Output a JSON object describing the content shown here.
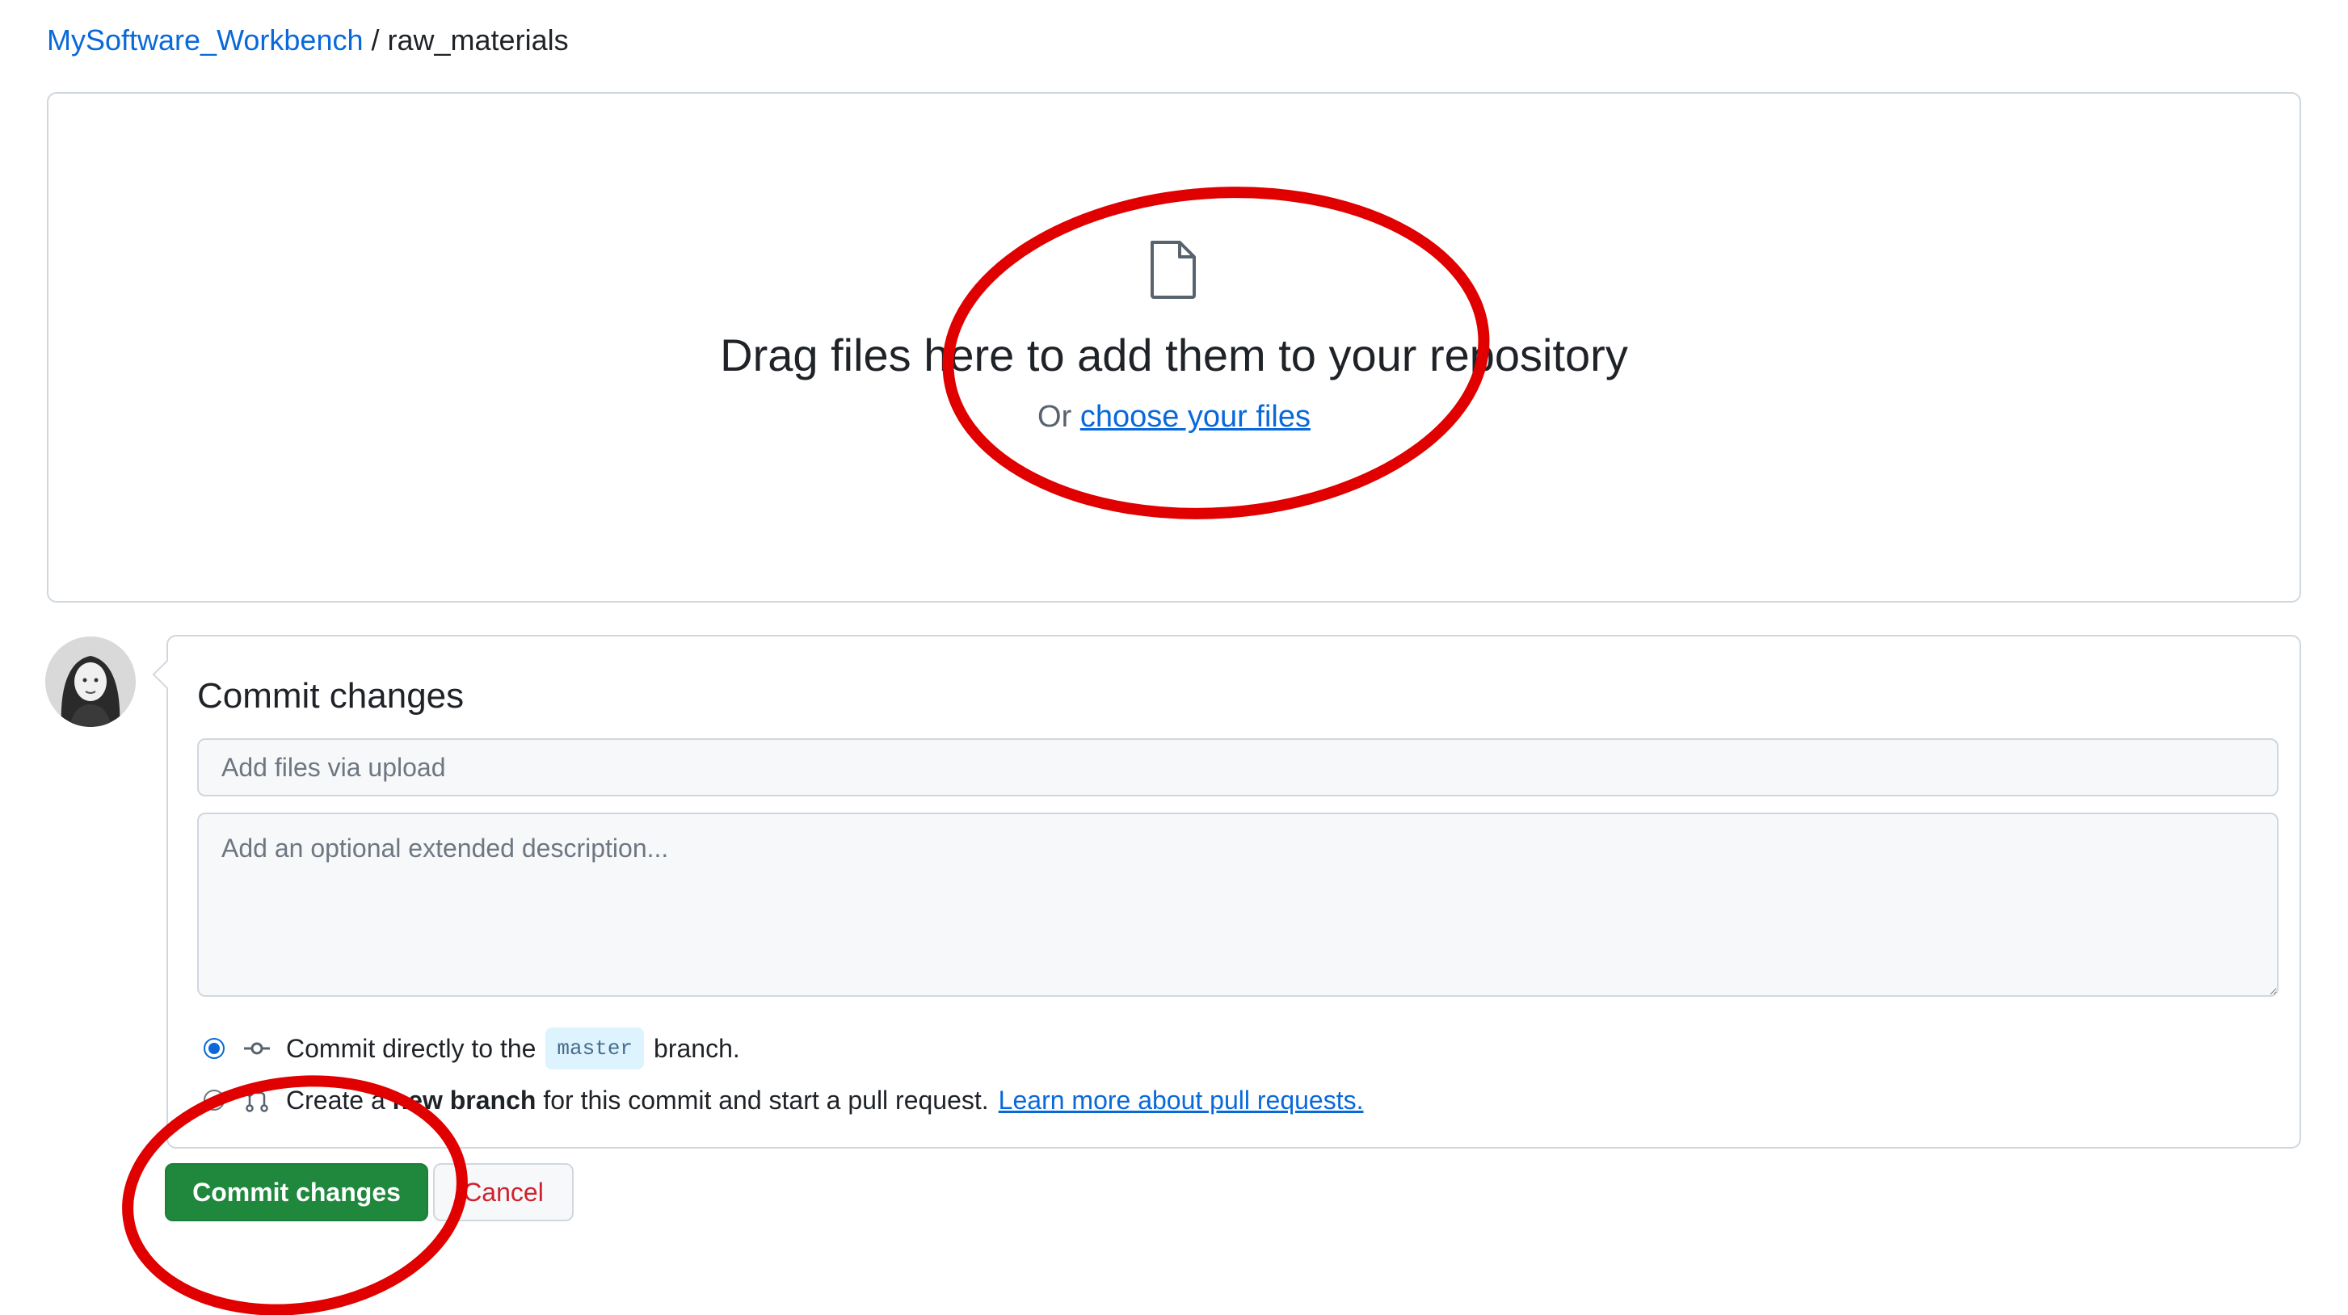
{
  "breadcrumb": {
    "repo": "MySoftware_Workbench",
    "separator": "/",
    "folder": "raw_materials"
  },
  "dropzone": {
    "icon": "file-icon",
    "title": "Drag files here to add them to your repository",
    "or_text": "Or",
    "choose_link": "choose your files"
  },
  "commit": {
    "title": "Commit changes",
    "summary_placeholder": "Add files via upload",
    "description_placeholder": "Add an optional extended description...",
    "option_direct": {
      "prefix": "Commit directly to the",
      "branch": "master",
      "suffix": "branch.",
      "selected": true,
      "icon": "git-commit-icon"
    },
    "option_new_branch": {
      "prefix": "Create a",
      "bold": "new branch",
      "suffix": "for this commit and start a pull request.",
      "link": "Learn more about pull requests.",
      "selected": false,
      "icon": "git-pull-request-icon"
    },
    "commit_button": "Commit changes",
    "cancel_button": "Cancel"
  },
  "colors": {
    "link": "#0969da",
    "primary_button": "#1f883d",
    "cancel_text": "#cf222e",
    "annotation": "#e00000"
  }
}
